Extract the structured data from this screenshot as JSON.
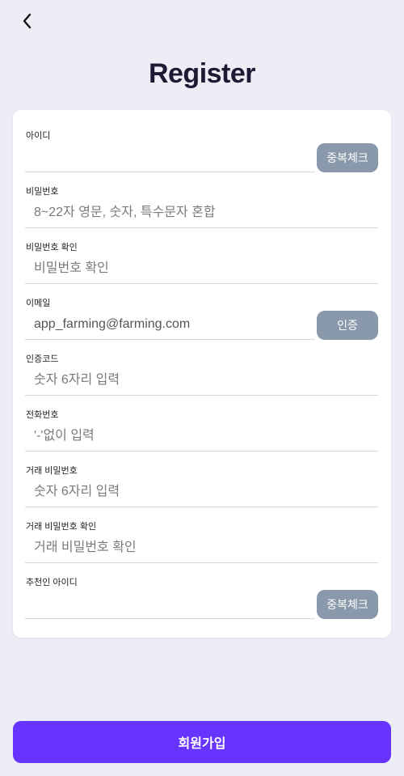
{
  "header": {
    "title": "Register"
  },
  "form": {
    "fields": [
      {
        "label": "아이디",
        "placeholder": "",
        "value": "",
        "button": "중복체크"
      },
      {
        "label": "비밀번호",
        "placeholder": "8~22자 영문, 숫자, 특수문자 혼합",
        "value": ""
      },
      {
        "label": "비밀번호 확인",
        "placeholder": "비밀번호 확인",
        "value": ""
      },
      {
        "label": "이메일",
        "placeholder": "",
        "value": "app_farming@farming.com",
        "button": "인증"
      },
      {
        "label": "인증코드",
        "placeholder": "숫자 6자리 입력",
        "value": ""
      },
      {
        "label": "전화번호",
        "placeholder": "'-'없이 입력",
        "value": ""
      },
      {
        "label": "거래 비밀번호",
        "placeholder": "숫자 6자리 입력",
        "value": ""
      },
      {
        "label": "거래 비밀번호 확인",
        "placeholder": "거래 비밀번호 확인",
        "value": ""
      },
      {
        "label": "추천인 아이디",
        "placeholder": "",
        "value": "",
        "button": "중복체크"
      }
    ]
  },
  "footer": {
    "submit_label": "회원가입"
  },
  "colors": {
    "background": "#ecedf5",
    "card": "#ffffff",
    "side_button": "#8a98ab",
    "primary": "#6633ff",
    "title": "#1d1a33"
  },
  "icons": {
    "back": "chevron-left-icon"
  }
}
